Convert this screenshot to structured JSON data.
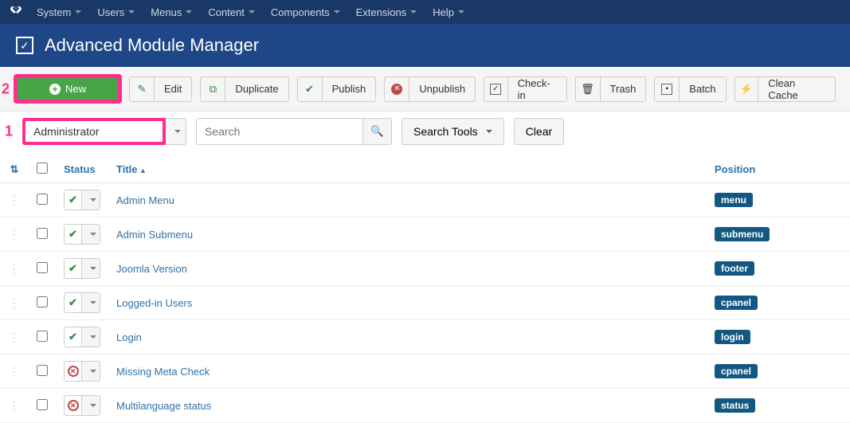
{
  "nav": {
    "items": [
      "System",
      "Users",
      "Menus",
      "Content",
      "Components",
      "Extensions",
      "Help"
    ]
  },
  "header": {
    "title": "Advanced Module Manager"
  },
  "toolbar": {
    "new": "New",
    "edit": "Edit",
    "duplicate": "Duplicate",
    "publish": "Publish",
    "unpublish": "Unpublish",
    "checkin": "Check-in",
    "trash": "Trash",
    "batch": "Batch",
    "clean_cache": "Clean Cache"
  },
  "filter": {
    "client": "Administrator",
    "search_placeholder": "Search",
    "search_tools": "Search Tools",
    "clear": "Clear"
  },
  "columns": {
    "status": "Status",
    "title": "Title",
    "position": "Position"
  },
  "rows": [
    {
      "status": "ok",
      "title": "Admin Menu",
      "position": "menu"
    },
    {
      "status": "ok",
      "title": "Admin Submenu",
      "position": "submenu"
    },
    {
      "status": "ok",
      "title": "Joomla Version",
      "position": "footer"
    },
    {
      "status": "ok",
      "title": "Logged-in Users",
      "position": "cpanel"
    },
    {
      "status": "ok",
      "title": "Login",
      "position": "login"
    },
    {
      "status": "bad",
      "title": "Missing Meta Check",
      "position": "cpanel"
    },
    {
      "status": "bad",
      "title": "Multilanguage status",
      "position": "status"
    }
  ],
  "annotations": {
    "one": "1",
    "two": "2"
  }
}
